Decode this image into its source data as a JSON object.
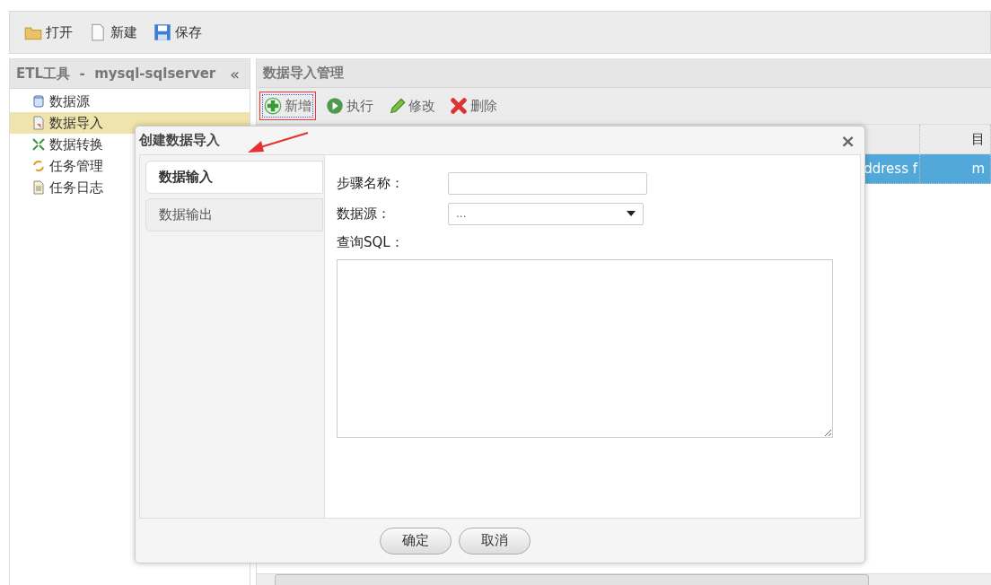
{
  "main_toolbar": [
    {
      "label": "打开"
    },
    {
      "label": "新建"
    },
    {
      "label": "保存"
    }
  ],
  "sidebar": {
    "title": "ETL工具  -  mysql-sqlserver",
    "collapse": "«",
    "items": [
      {
        "label": "数据源",
        "selected": false
      },
      {
        "label": "数据导入",
        "selected": true
      },
      {
        "label": "数据转换",
        "selected": false
      },
      {
        "label": "任务管理",
        "selected": false
      },
      {
        "label": "任务日志",
        "selected": false
      }
    ]
  },
  "panel": {
    "title": "数据导入管理",
    "actions": [
      {
        "label": "新增",
        "highlighted": true
      },
      {
        "label": "执行",
        "highlighted": false
      },
      {
        "label": "修改",
        "highlighted": false
      },
      {
        "label": "删除",
        "highlighted": false
      }
    ],
    "table": {
      "columns": [
        "",
        "目"
      ],
      "rows": [
        {
          "selected": true,
          "cells": [
            "ddress f",
            "m"
          ]
        }
      ]
    }
  },
  "dialog": {
    "title": "创建数据导入",
    "close": "×",
    "tabs": [
      {
        "label": "数据输入",
        "selected": true
      },
      {
        "label": "数据输出",
        "selected": false
      }
    ],
    "form": {
      "step_name": {
        "label": "步骤名称："
      },
      "datasource": {
        "label": "数据源：",
        "value": "..."
      },
      "sql": {
        "label": "查询SQL："
      }
    },
    "buttons": [
      "确定",
      "取消"
    ]
  }
}
